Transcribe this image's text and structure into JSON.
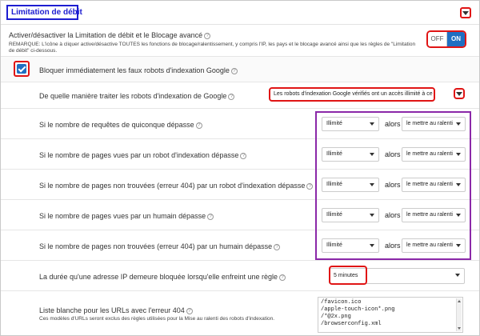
{
  "header": {
    "title": "Limitation de débit"
  },
  "main_toggle": {
    "label": "Activer/désactiver la Limitation de débit et le Blocage avancé",
    "note": "REMARQUE: L'icône à cliquer active/désactive TOUTES les fonctions de blocage/ralentissement, y compris l'IP, les pays et le blocage avancé ainsi que les règles de \"Limitation de débit\" ci-dessous.",
    "off_label": "OFF",
    "on_label": "ON",
    "state": "on"
  },
  "block_fake_bots": {
    "label": "Bloquer immédiatement les faux robots d'indexation Google",
    "checked": true
  },
  "google_bots": {
    "label": "De quelle manière traiter les robots d'indexation de Google",
    "value": "Les robots d'indexation Google vérifiés ont un accès illimité à ce site"
  },
  "rules": [
    {
      "label": "Si le nombre de requêtes de quiconque dépasse",
      "limit": "Illimité",
      "joiner": "alors",
      "action": "le mettre au ralenti"
    },
    {
      "label": "Si le nombre de pages vues par un robot d'indexation dépasse",
      "limit": "Illimité",
      "joiner": "alors",
      "action": "le mettre au ralenti"
    },
    {
      "label": "Si le nombre de pages non trouvées (erreur 404) par un robot d'indexation dépasse",
      "limit": "Illimité",
      "joiner": "alors",
      "action": "le mettre au ralenti"
    },
    {
      "label": "Si le nombre de pages vues par un humain dépasse",
      "limit": "Illimité",
      "joiner": "alors",
      "action": "le mettre au ralenti"
    },
    {
      "label": "Si le nombre de pages non trouvées (erreur 404) par un humain dépasse",
      "limit": "Illimité",
      "joiner": "alors",
      "action": "le mettre au ralenti"
    }
  ],
  "block_duration": {
    "label": "La durée qu'une adresse IP demeure bloquée lorsqu'elle enfreint une règle",
    "value": "5 minutes"
  },
  "whitelist": {
    "label": "Liste blanche pour les URLs avec l'erreur 404",
    "note": "Ces modèles d'URLs seront exclus des règles utilisées pour la Mise au ralenti des robots d'indexation.",
    "entries": "/favicon.ico\n/apple-touch-icon*.png\n/*@2x.png\n/browserconfig.xml"
  },
  "colors": {
    "accent": "#1f6fc2",
    "highlight_red": "#e01515",
    "highlight_blue": "#1d1dd1",
    "highlight_purple": "#8b28a8"
  },
  "icons": {
    "help": "question-circle-icon",
    "dropdown": "chevron-down-icon",
    "check": "check-icon"
  }
}
